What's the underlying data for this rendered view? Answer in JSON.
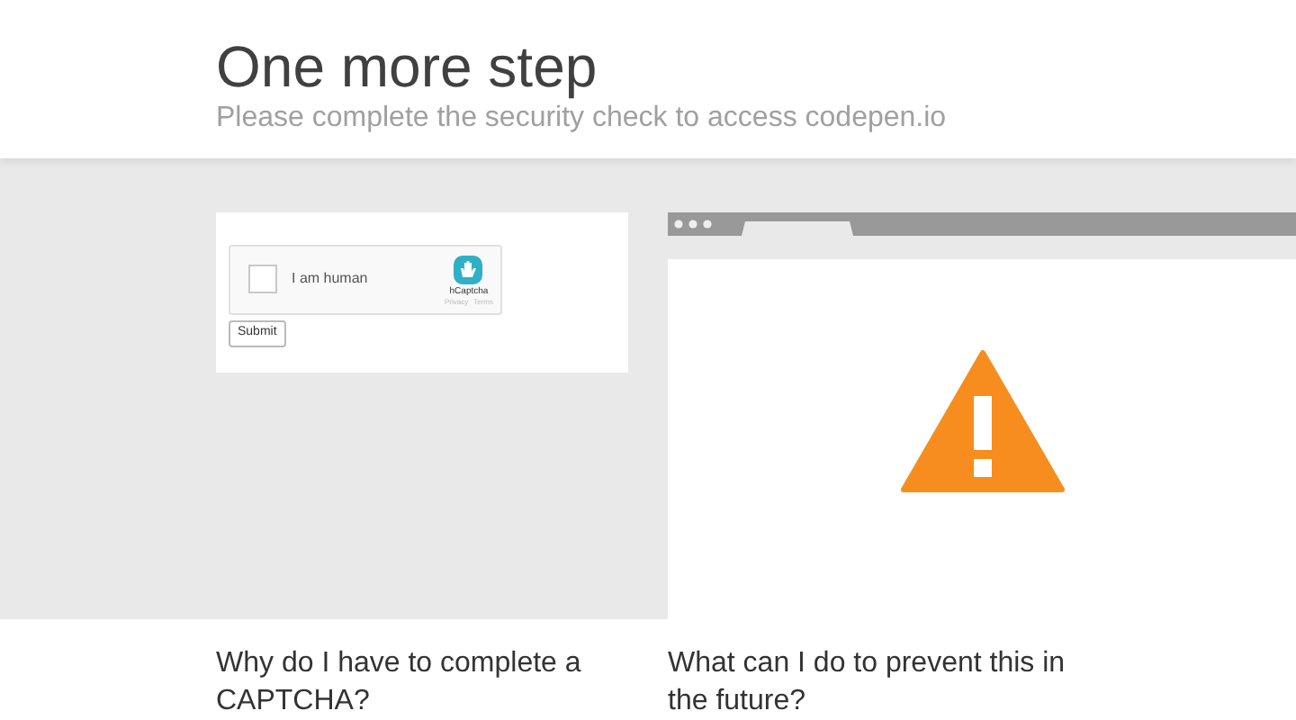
{
  "header": {
    "title": "One more step",
    "subtitle": "Please complete the security check to access codepen.io"
  },
  "captcha": {
    "label": "I am human",
    "checked": false,
    "brand": "hCaptcha",
    "links": [
      "Privacy",
      "Terms"
    ],
    "submit": "Submit"
  },
  "questions": [
    "Why do I have to complete a CAPTCHA?",
    "What can I do to prevent this in the future?"
  ]
}
